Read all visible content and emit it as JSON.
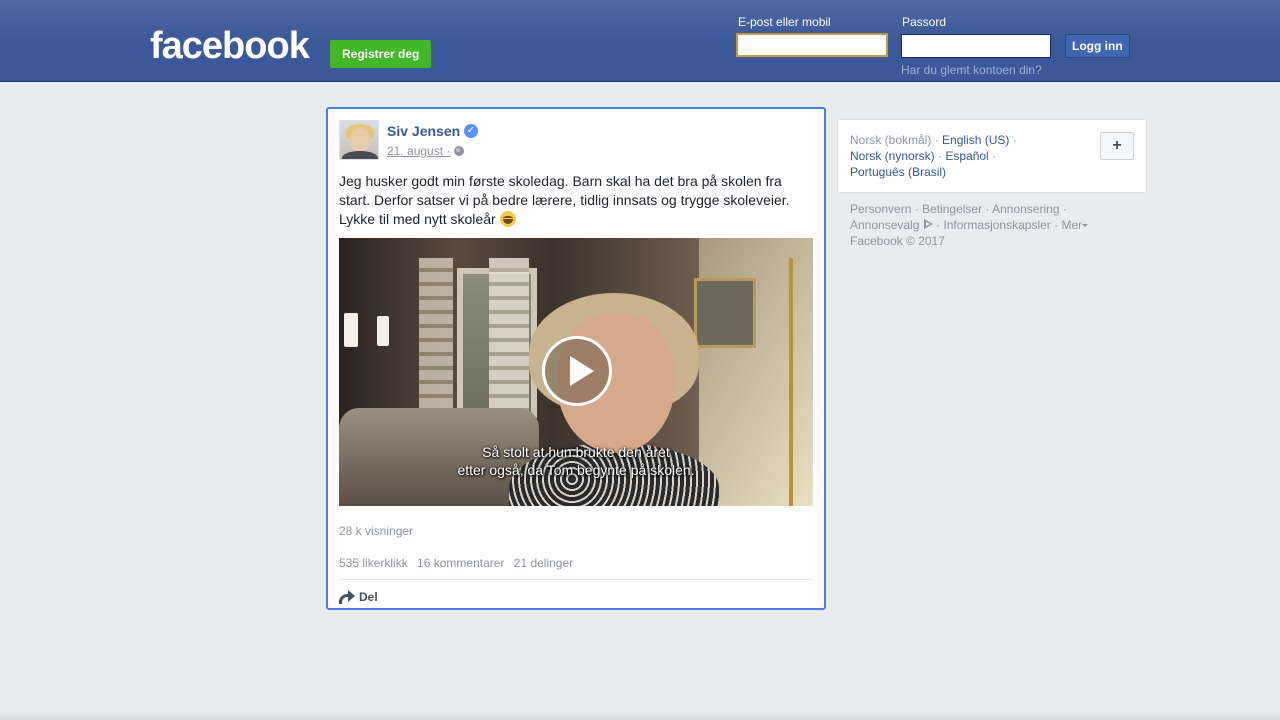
{
  "header": {
    "logo_text": "facebook",
    "register_label": "Registrer deg",
    "email_label": "E-post eller mobil",
    "email_value": "",
    "password_label": "Passord",
    "password_value": "",
    "login_label": "Logg inn",
    "forgot_label": "Har du glemt kontoen din?",
    "brand_color": "#3b5998"
  },
  "post": {
    "author": "Siv Jensen",
    "verified_icon": "verified-icon",
    "date": "21. august ·",
    "privacy_icon": "globe-icon",
    "text": "Jeg husker godt min første skoledag. Barn skal ha det bra på skolen fra start. Derfor satser vi på bedre lærere, tidlig innsats og trygge skoleveier. Lykke til med nytt skoleår",
    "emoji_icon": "laughing-emoji-icon",
    "video": {
      "subtitle_line1": "Så stolt at hun brukte den året",
      "subtitle_line2": "etter også, da Tom begynte på skolen."
    },
    "views": "28 k visninger",
    "likes": "535 likerklikk",
    "comments": "16 kommentarer",
    "shares": "21 delinger",
    "share_label": "Del"
  },
  "sidebar": {
    "languages": {
      "current": "Norsk (bokmål)",
      "links": [
        "English (US)",
        "Norsk (nynorsk)",
        "Español",
        "Português (Brasil)"
      ],
      "plus_label": "+"
    },
    "footer": {
      "links": [
        "Personvern",
        "Betingelser",
        "Annonsering",
        "Annonsevalg",
        "Informasjonskapsler",
        "Mer"
      ],
      "copyright": "Facebook © 2017"
    }
  }
}
